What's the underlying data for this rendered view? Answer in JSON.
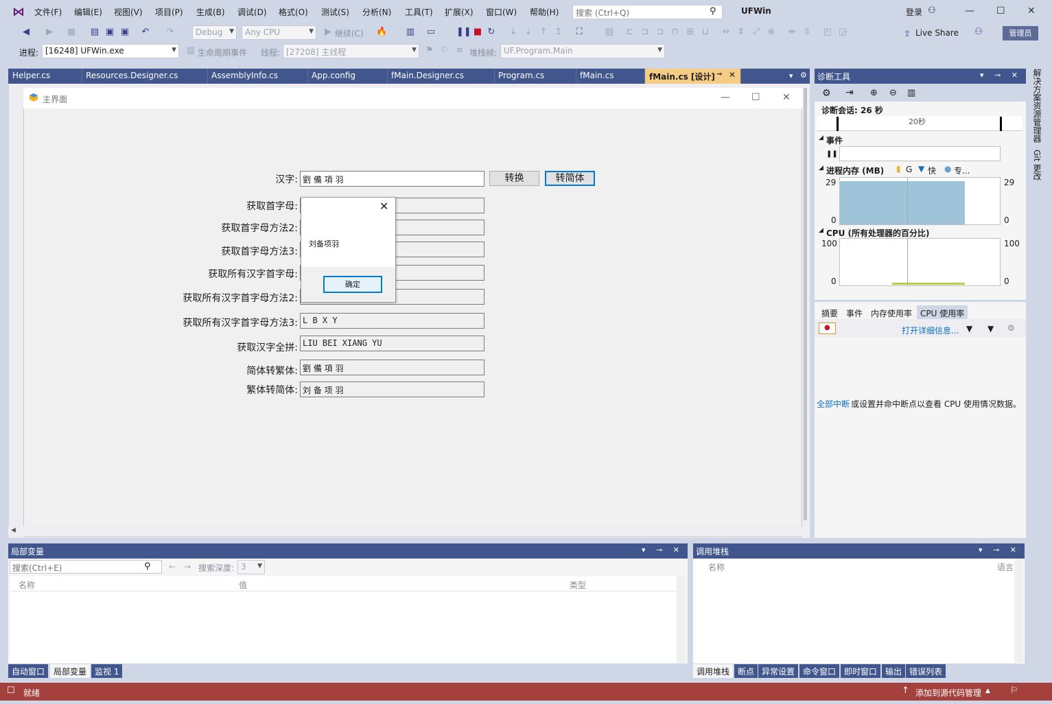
{
  "menubar": {
    "items": [
      "文件(F)",
      "编辑(E)",
      "视图(V)",
      "项目(P)",
      "生成(B)",
      "调试(D)",
      "格式(O)",
      "测试(S)",
      "分析(N)",
      "工具(T)",
      "扩展(X)",
      "窗口(W)",
      "帮助(H)"
    ],
    "search_placeholder": "搜索 (Ctrl+Q)",
    "app_name": "UFWin",
    "login": "登录"
  },
  "toolbar": {
    "config": "Debug",
    "platform": "Any CPU",
    "continue_label": "继续(C)",
    "live_share": "Live Share",
    "admin": "管理员"
  },
  "toolbar2": {
    "process_label": "进程:",
    "process_value": "[16248] UFWin.exe",
    "lifecycle_label": "生命周期事件",
    "thread_label": "线程:",
    "thread_value": "[27208] 主线程",
    "stackframe_label": "堆栈帧:",
    "stackframe_value": "UF.Program.Main"
  },
  "doc_tabs": [
    "Helper.cs",
    "Resources.Designer.cs",
    "AssemblyInfo.cs",
    "App.config",
    "fMain.Designer.cs",
    "Program.cs",
    "fMain.cs",
    "fMain.cs [设计]"
  ],
  "form": {
    "title": "主界面",
    "hanzi_label": "汉字:",
    "hanzi_value": "劉 備 項 羽",
    "convert_btn": "转换",
    "to_simplified_btn": "转简体",
    "rows": [
      {
        "label": "获取首字母:",
        "value": ""
      },
      {
        "label": "获取首字母方法2:",
        "value": ""
      },
      {
        "label": "获取首字母方法3:",
        "value": ""
      },
      {
        "label": "获取所有汉字首字母:",
        "value": ""
      },
      {
        "label": "获取所有汉字首字母方法2:",
        "value": ""
      },
      {
        "label": "获取所有汉字首字母方法3:",
        "value": "L B X Y"
      },
      {
        "label": "获取汉字全拼:",
        "value": "LIU BEI XIANG YU"
      },
      {
        "label": "简体转繁体:",
        "value": "劉 備 項 羽"
      },
      {
        "label": "繁体转简体:",
        "value": "刘 备 项 羽"
      }
    ]
  },
  "messagebox": {
    "text": "刘备项羽",
    "ok": "确定"
  },
  "diagnostics": {
    "title": "诊断工具",
    "session": "诊断会话: 26 秒",
    "tick": "20秒",
    "events_label": "事件",
    "memory_label": "进程内存 (MB)",
    "memory_legend": [
      "G",
      "快",
      "专..."
    ],
    "mem_max": "29",
    "mem_min": "0",
    "cpu_label": "CPU (所有处理器的百分比)",
    "cpu_max": "100",
    "cpu_min": "0",
    "subtabs": [
      "摘要",
      "事件",
      "内存使用率",
      "CPU 使用率"
    ],
    "open_details": "打开详细信息...",
    "break_all": "全部中断",
    "break_msg": " 或设置并命中断点以查看 CPU 使用情况数据。"
  },
  "right_rail": [
    "解决方案资源管理器",
    "Git 更改"
  ],
  "locals": {
    "title": "局部变量",
    "search_placeholder": "搜索(Ctrl+E)",
    "depth_label": "搜索深度:",
    "depth_value": "3",
    "columns": [
      "名称",
      "值",
      "类型"
    ],
    "tabs": [
      "自动窗口",
      "局部变量",
      "监视 1"
    ]
  },
  "callstack": {
    "title": "调用堆栈",
    "columns": [
      "名称",
      "语言"
    ],
    "tabs": [
      "调用堆栈",
      "断点",
      "异常设置",
      "命令窗口",
      "即时窗口",
      "输出",
      "错误列表"
    ]
  },
  "status": {
    "ready": "就绪",
    "source_control": "添加到源代码管理"
  }
}
